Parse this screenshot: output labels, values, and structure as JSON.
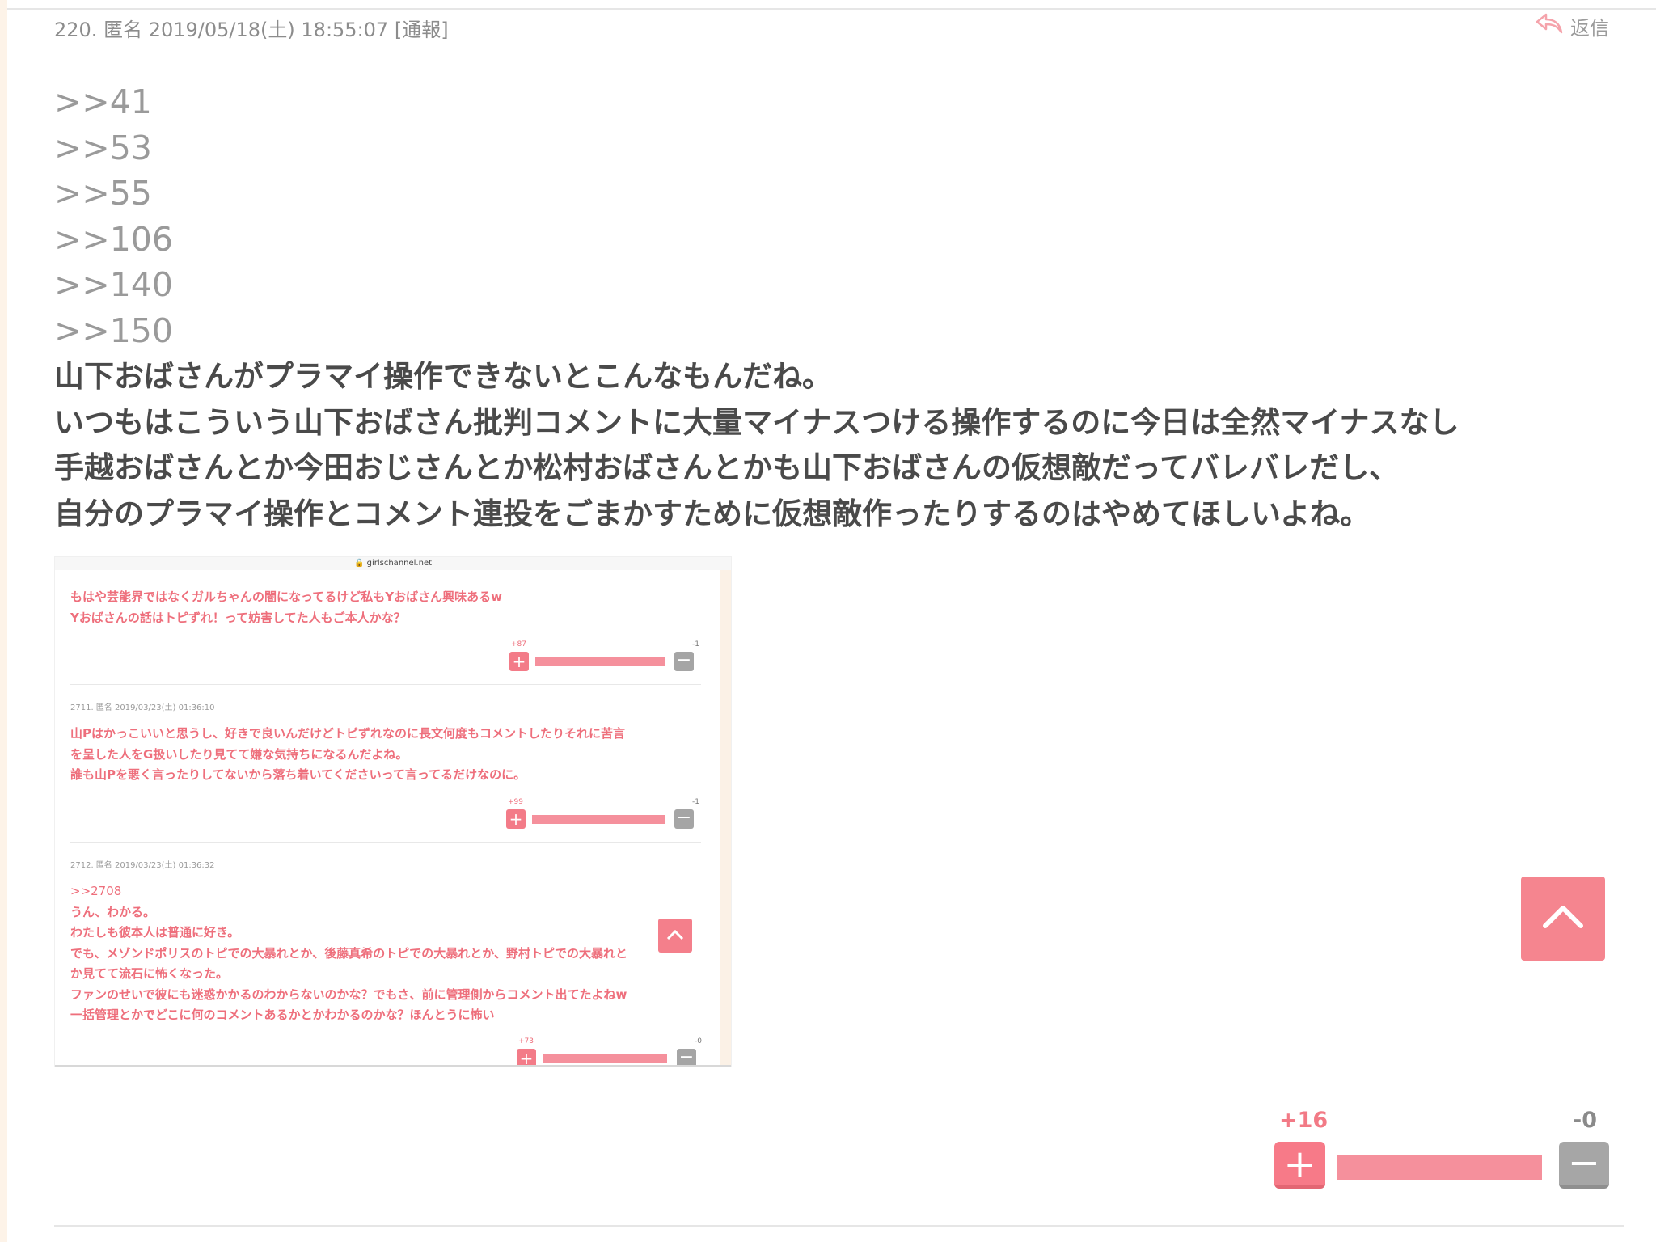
{
  "comment": {
    "number": "220.",
    "author": "匿名",
    "datetime": "2019/05/18(土) 18:55:07",
    "report_label": "[通報]",
    "reply_label": "返信",
    "anchors": [
      ">>41",
      ">>53",
      ">>55",
      ">>106",
      ">>140",
      ">>150"
    ],
    "lines": [
      "山下おばさんがプラマイ操作できないとこんなもんだね。",
      "いつもはこういう山下おばさん批判コメントに大量マイナスつける操作するのに今日は全然マイナスなし",
      "手越おばさんとか今田おじさんとか松村おばさんとかも山下おばさんの仮想敵だってバレバレだし、",
      "自分のプラマイ操作とコメント連投をごまかすために仮想敵作ったりするのはやめてほしいよね。"
    ],
    "plus_count": "+16",
    "minus_count": "-0"
  },
  "screenshot": {
    "url": "girlschannel.net",
    "posts": [
      {
        "meta": "",
        "anchor": "",
        "lines": [
          "もはや芸能界ではなくガルちゃんの闇になってるけど私もYおばさん興味あるw",
          "Yおばさんの話はトピずれ！って妨害してた人もご本人かな？"
        ],
        "plus": "+87",
        "minus": "-1"
      },
      {
        "meta": "2711. 匿名 2019/03/23(土) 01:36:10",
        "anchor": "",
        "lines": [
          "山Pはかっこいいと思うし、好きで良いんだけどトピずれなのに長文何度もコメントしたりそれに苦言",
          "を呈した人をG扱いしたり見てて嫌な気持ちになるんだよね。",
          "誰も山Pを悪く言ったりしてないから落ち着いてくださいって言ってるだけなのに。"
        ],
        "plus": "+99",
        "minus": "-1"
      },
      {
        "meta": "2712. 匿名 2019/03/23(土) 01:36:32",
        "anchor": ">>2708",
        "lines": [
          "うん、わかる。",
          "わたしも彼本人は普通に好き。",
          "でも、メゾンドポリスのトピでの大暴れとか、後藤真希のトピでの大暴れとか、野村トピでの大暴れと",
          "か見てて流石に怖くなった。",
          "ファンのせいで彼にも迷惑かかるのわからないのかな？でもさ、前に管理側からコメント出てたよねw",
          "一括管理とかでどこに何のコメントあるかとかわかるのかな？ほんとうに怖い"
        ],
        "plus": "+73",
        "minus": "-0"
      }
    ]
  },
  "icons": {
    "reply": "reply-arrow-icon",
    "scroll_top": "chevron-up-icon"
  },
  "colors": {
    "accent": "#f77a88",
    "minus": "#a6a6a6",
    "text": "#4a4a4a"
  }
}
